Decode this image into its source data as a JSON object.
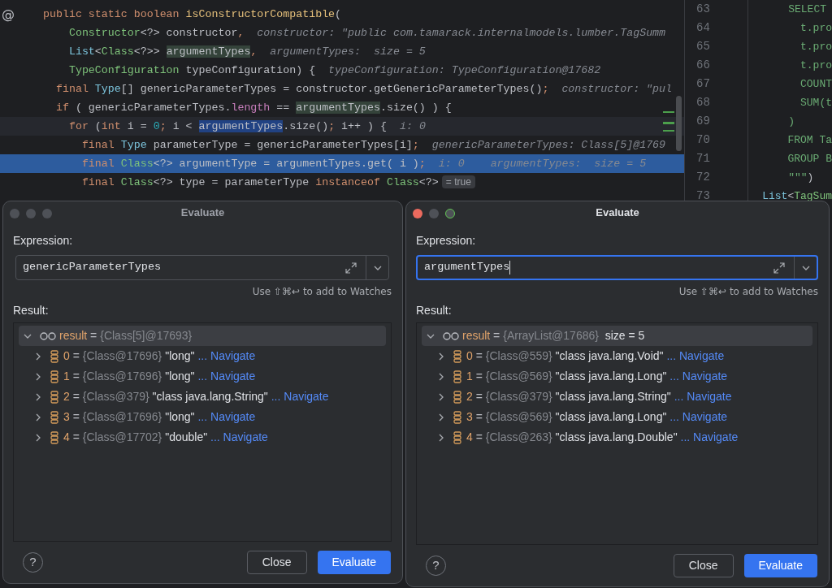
{
  "editor": {
    "lines": [
      {
        "kind": "plain",
        "gutter": "@",
        "tokens": [
          {
            "t": "public ",
            "kind": "kw"
          },
          {
            "t": "static ",
            "kind": "kw"
          },
          {
            "t": "boolean ",
            "kind": "kw"
          },
          {
            "t": "isConstructorCompatible",
            "kind": "fn"
          },
          {
            "t": "(",
            "kind": "plain"
          }
        ]
      },
      {
        "kind": "plain",
        "tokens": [
          {
            "t": "    Constructor",
            "kind": "type"
          },
          {
            "t": "<?> constructor",
            "kind": "plain"
          },
          {
            "t": ",  ",
            "kind": "punct"
          },
          {
            "t": "constructor: \"public com.tamarack.internalmodels.lumber.TagSumm",
            "kind": "hint"
          }
        ]
      },
      {
        "kind": "plain",
        "tokens": [
          {
            "t": "    List",
            "kind": "iface"
          },
          {
            "t": "<",
            "kind": "plain"
          },
          {
            "t": "Class",
            "kind": "type"
          },
          {
            "t": "<?>> ",
            "kind": "plain"
          },
          {
            "t": "argumentTypes",
            "kind": "usage"
          },
          {
            "t": ",  ",
            "kind": "punct"
          },
          {
            "t": "argumentTypes:  size = 5",
            "kind": "hint"
          }
        ]
      },
      {
        "kind": "plain",
        "tokens": [
          {
            "t": "    TypeConfiguration",
            "kind": "type"
          },
          {
            "t": " typeConfiguration) {  ",
            "kind": "plain"
          },
          {
            "t": "typeConfiguration: TypeConfiguration@17682",
            "kind": "hint"
          }
        ]
      },
      {
        "kind": "plain",
        "tokens": [
          {
            "t": "  final ",
            "kind": "kw"
          },
          {
            "t": "Type",
            "kind": "iface"
          },
          {
            "t": "[] genericParameterTypes = constructor.getGenericParameterTypes()",
            "kind": "plain"
          },
          {
            "t": ";  ",
            "kind": "punct"
          },
          {
            "t": "constructor: \"pul",
            "kind": "hint"
          }
        ]
      },
      {
        "kind": "plain",
        "tokens": [
          {
            "t": "  if",
            "kind": "kw"
          },
          {
            "t": " ( genericParameterTypes.",
            "kind": "plain"
          },
          {
            "t": "length",
            "kind": "field"
          },
          {
            "t": " == ",
            "kind": "plain"
          },
          {
            "t": "argumentTypes",
            "kind": "usage"
          },
          {
            "t": ".size() ) {",
            "kind": "plain"
          }
        ]
      },
      {
        "kind": "caret",
        "tokens": [
          {
            "t": "    for",
            "kind": "kw"
          },
          {
            "t": " (",
            "kind": "plain"
          },
          {
            "t": "int",
            "kind": "kw"
          },
          {
            "t": " i = ",
            "kind": "plain"
          },
          {
            "t": "0",
            "kind": "num"
          },
          {
            "t": ";",
            "kind": "punct"
          },
          {
            "t": " i < ",
            "kind": "plain"
          },
          {
            "t": "argumentTypes",
            "kind": "selection"
          },
          {
            "t": ".size()",
            "kind": "plain"
          },
          {
            "t": ";",
            "kind": "punct"
          },
          {
            "t": " i++ ) {  ",
            "kind": "plain"
          },
          {
            "t": "i: 0",
            "kind": "hint"
          }
        ]
      },
      {
        "kind": "plain",
        "tokens": [
          {
            "t": "      final ",
            "kind": "kw"
          },
          {
            "t": "Type",
            "kind": "iface"
          },
          {
            "t": " parameterType = genericParameterTypes[i]",
            "kind": "plain"
          },
          {
            "t": ";  ",
            "kind": "punct"
          },
          {
            "t": "genericParameterTypes: Class[5]@1769",
            "kind": "hint"
          }
        ]
      },
      {
        "kind": "execution",
        "tokens": [
          {
            "t": "      final ",
            "kind": "kw"
          },
          {
            "t": "Class",
            "kind": "type"
          },
          {
            "t": "<?> argumentType = argumentTypes.get( i )",
            "kind": "plain"
          },
          {
            "t": ";  ",
            "kind": "punct"
          },
          {
            "t": "i: 0    ",
            "kind": "hint"
          },
          {
            "t": "argumentTypes:  size = 5",
            "kind": "hint"
          }
        ]
      },
      {
        "kind": "plain",
        "tokens": [
          {
            "t": "      final ",
            "kind": "kw"
          },
          {
            "t": "Class",
            "kind": "type"
          },
          {
            "t": "<?> type = parameterType ",
            "kind": "plain"
          },
          {
            "t": "instanceof ",
            "kind": "kw"
          },
          {
            "t": "Class",
            "kind": "type"
          },
          {
            "t": "<?>",
            "kind": "plain"
          },
          {
            "t": "= true",
            "kind": "inlay"
          }
        ]
      }
    ]
  },
  "side_editor": {
    "lines": [
      {
        "number": "63",
        "tokens": [
          {
            "t": "    SELECT",
            "kind": "str"
          }
        ]
      },
      {
        "number": "64",
        "tokens": [
          {
            "t": "      t.pro",
            "kind": "str"
          }
        ]
      },
      {
        "number": "65",
        "tokens": [
          {
            "t": "      t.pro",
            "kind": "str"
          }
        ]
      },
      {
        "number": "66",
        "tokens": [
          {
            "t": "      t.pro",
            "kind": "str"
          }
        ]
      },
      {
        "number": "67",
        "tokens": [
          {
            "t": "      COUNT",
            "kind": "str"
          }
        ]
      },
      {
        "number": "68",
        "tokens": [
          {
            "t": "      SUM(t",
            "kind": "str"
          }
        ]
      },
      {
        "number": "69",
        "tokens": [
          {
            "t": "    )",
            "kind": "str"
          }
        ]
      },
      {
        "number": "70",
        "tokens": [
          {
            "t": "    FROM Ta",
            "kind": "str"
          }
        ]
      },
      {
        "number": "71",
        "tokens": [
          {
            "t": "    GROUP B",
            "kind": "str"
          }
        ]
      },
      {
        "number": "72",
        "tokens": [
          {
            "t": "    \"\"\"",
            "kind": "str"
          },
          {
            "t": ")",
            "kind": "plain"
          }
        ]
      },
      {
        "number": "73",
        "tokens": [
          {
            "t": "List",
            "kind": "iface"
          },
          {
            "t": "<",
            "kind": "plain"
          },
          {
            "t": "TagSum",
            "kind": "type"
          }
        ]
      }
    ]
  },
  "dialogs": [
    {
      "title": "Evaluate",
      "active": false,
      "expression_label": "Expression:",
      "expression": "genericParameterTypes",
      "focused": false,
      "hint": "Use ⇧⌘↩ to add to Watches",
      "result_label": "Result:",
      "result": {
        "expanded": true,
        "name": "result",
        "eq": "=",
        "value": "{Class[5]@17693}",
        "children": [
          {
            "index": "0",
            "eq": "=",
            "ref": "{Class@17696}",
            "value": "\"long\"",
            "link": "... Navigate",
            "expanded": false
          },
          {
            "index": "1",
            "eq": "=",
            "ref": "{Class@17696}",
            "value": "\"long\"",
            "link": "... Navigate",
            "expanded": false
          },
          {
            "index": "2",
            "eq": "=",
            "ref": "{Class@379}",
            "value": "\"class java.lang.String\"",
            "link": "... Navigate",
            "expanded": false
          },
          {
            "index": "3",
            "eq": "=",
            "ref": "{Class@17696}",
            "value": "\"long\"",
            "link": "... Navigate",
            "expanded": false
          },
          {
            "index": "4",
            "eq": "=",
            "ref": "{Class@17702}",
            "value": "\"double\"",
            "link": "... Navigate",
            "expanded": false
          }
        ]
      },
      "help": "?",
      "buttons": [
        {
          "label": "Close",
          "kind": "secondary"
        },
        {
          "label": "Evaluate",
          "kind": "primary"
        }
      ]
    },
    {
      "title": "Evaluate",
      "active": true,
      "expression_label": "Expression:",
      "expression": "argumentTypes",
      "focused": true,
      "hint": "Use ⇧⌘↩ to add to Watches",
      "result_label": "Result:",
      "result": {
        "expanded": true,
        "name": "result",
        "eq": "=",
        "value": "{ArrayList@17686}",
        "extra": "size = 5",
        "children": [
          {
            "index": "0",
            "eq": "=",
            "ref": "{Class@559}",
            "value": "\"class java.lang.Void\"",
            "link": "... Navigate",
            "expanded": false
          },
          {
            "index": "1",
            "eq": "=",
            "ref": "{Class@569}",
            "value": "\"class java.lang.Long\"",
            "link": "... Navigate",
            "expanded": false
          },
          {
            "index": "2",
            "eq": "=",
            "ref": "{Class@379}",
            "value": "\"class java.lang.String\"",
            "link": "... Navigate",
            "expanded": false
          },
          {
            "index": "3",
            "eq": "=",
            "ref": "{Class@569}",
            "value": "\"class java.lang.Long\"",
            "link": "... Navigate",
            "expanded": false
          },
          {
            "index": "4",
            "eq": "=",
            "ref": "{Class@263}",
            "value": "\"class java.lang.Double\"",
            "link": "... Navigate",
            "expanded": false
          }
        ]
      },
      "help": "?",
      "buttons": [
        {
          "label": "Close",
          "kind": "secondary"
        },
        {
          "label": "Evaluate",
          "kind": "primary"
        }
      ]
    }
  ]
}
